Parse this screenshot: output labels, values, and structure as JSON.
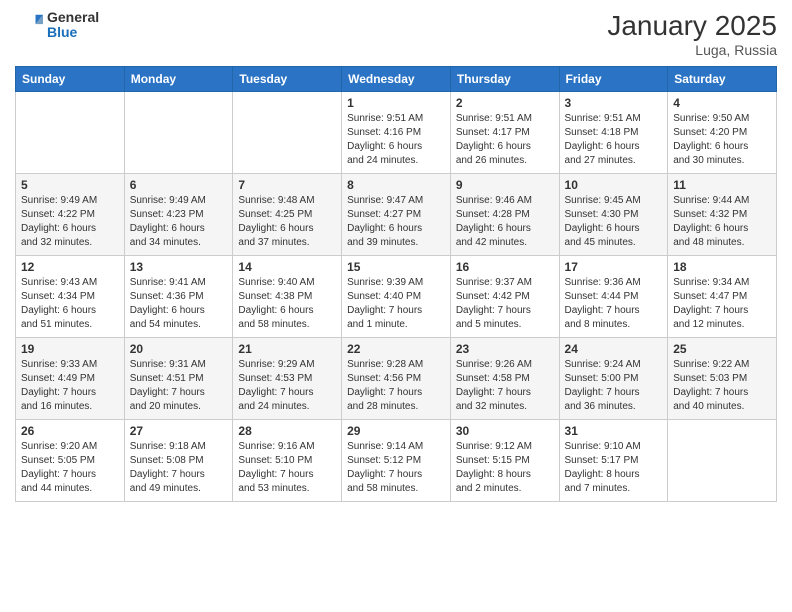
{
  "header": {
    "logo_general": "General",
    "logo_blue": "Blue",
    "month": "January 2025",
    "location": "Luga, Russia"
  },
  "days_of_week": [
    "Sunday",
    "Monday",
    "Tuesday",
    "Wednesday",
    "Thursday",
    "Friday",
    "Saturday"
  ],
  "weeks": [
    [
      {
        "day": "",
        "info": ""
      },
      {
        "day": "",
        "info": ""
      },
      {
        "day": "",
        "info": ""
      },
      {
        "day": "1",
        "info": "Sunrise: 9:51 AM\nSunset: 4:16 PM\nDaylight: 6 hours\nand 24 minutes."
      },
      {
        "day": "2",
        "info": "Sunrise: 9:51 AM\nSunset: 4:17 PM\nDaylight: 6 hours\nand 26 minutes."
      },
      {
        "day": "3",
        "info": "Sunrise: 9:51 AM\nSunset: 4:18 PM\nDaylight: 6 hours\nand 27 minutes."
      },
      {
        "day": "4",
        "info": "Sunrise: 9:50 AM\nSunset: 4:20 PM\nDaylight: 6 hours\nand 30 minutes."
      }
    ],
    [
      {
        "day": "5",
        "info": "Sunrise: 9:49 AM\nSunset: 4:22 PM\nDaylight: 6 hours\nand 32 minutes."
      },
      {
        "day": "6",
        "info": "Sunrise: 9:49 AM\nSunset: 4:23 PM\nDaylight: 6 hours\nand 34 minutes."
      },
      {
        "day": "7",
        "info": "Sunrise: 9:48 AM\nSunset: 4:25 PM\nDaylight: 6 hours\nand 37 minutes."
      },
      {
        "day": "8",
        "info": "Sunrise: 9:47 AM\nSunset: 4:27 PM\nDaylight: 6 hours\nand 39 minutes."
      },
      {
        "day": "9",
        "info": "Sunrise: 9:46 AM\nSunset: 4:28 PM\nDaylight: 6 hours\nand 42 minutes."
      },
      {
        "day": "10",
        "info": "Sunrise: 9:45 AM\nSunset: 4:30 PM\nDaylight: 6 hours\nand 45 minutes."
      },
      {
        "day": "11",
        "info": "Sunrise: 9:44 AM\nSunset: 4:32 PM\nDaylight: 6 hours\nand 48 minutes."
      }
    ],
    [
      {
        "day": "12",
        "info": "Sunrise: 9:43 AM\nSunset: 4:34 PM\nDaylight: 6 hours\nand 51 minutes."
      },
      {
        "day": "13",
        "info": "Sunrise: 9:41 AM\nSunset: 4:36 PM\nDaylight: 6 hours\nand 54 minutes."
      },
      {
        "day": "14",
        "info": "Sunrise: 9:40 AM\nSunset: 4:38 PM\nDaylight: 6 hours\nand 58 minutes."
      },
      {
        "day": "15",
        "info": "Sunrise: 9:39 AM\nSunset: 4:40 PM\nDaylight: 7 hours\nand 1 minute."
      },
      {
        "day": "16",
        "info": "Sunrise: 9:37 AM\nSunset: 4:42 PM\nDaylight: 7 hours\nand 5 minutes."
      },
      {
        "day": "17",
        "info": "Sunrise: 9:36 AM\nSunset: 4:44 PM\nDaylight: 7 hours\nand 8 minutes."
      },
      {
        "day": "18",
        "info": "Sunrise: 9:34 AM\nSunset: 4:47 PM\nDaylight: 7 hours\nand 12 minutes."
      }
    ],
    [
      {
        "day": "19",
        "info": "Sunrise: 9:33 AM\nSunset: 4:49 PM\nDaylight: 7 hours\nand 16 minutes."
      },
      {
        "day": "20",
        "info": "Sunrise: 9:31 AM\nSunset: 4:51 PM\nDaylight: 7 hours\nand 20 minutes."
      },
      {
        "day": "21",
        "info": "Sunrise: 9:29 AM\nSunset: 4:53 PM\nDaylight: 7 hours\nand 24 minutes."
      },
      {
        "day": "22",
        "info": "Sunrise: 9:28 AM\nSunset: 4:56 PM\nDaylight: 7 hours\nand 28 minutes."
      },
      {
        "day": "23",
        "info": "Sunrise: 9:26 AM\nSunset: 4:58 PM\nDaylight: 7 hours\nand 32 minutes."
      },
      {
        "day": "24",
        "info": "Sunrise: 9:24 AM\nSunset: 5:00 PM\nDaylight: 7 hours\nand 36 minutes."
      },
      {
        "day": "25",
        "info": "Sunrise: 9:22 AM\nSunset: 5:03 PM\nDaylight: 7 hours\nand 40 minutes."
      }
    ],
    [
      {
        "day": "26",
        "info": "Sunrise: 9:20 AM\nSunset: 5:05 PM\nDaylight: 7 hours\nand 44 minutes."
      },
      {
        "day": "27",
        "info": "Sunrise: 9:18 AM\nSunset: 5:08 PM\nDaylight: 7 hours\nand 49 minutes."
      },
      {
        "day": "28",
        "info": "Sunrise: 9:16 AM\nSunset: 5:10 PM\nDaylight: 7 hours\nand 53 minutes."
      },
      {
        "day": "29",
        "info": "Sunrise: 9:14 AM\nSunset: 5:12 PM\nDaylight: 7 hours\nand 58 minutes."
      },
      {
        "day": "30",
        "info": "Sunrise: 9:12 AM\nSunset: 5:15 PM\nDaylight: 8 hours\nand 2 minutes."
      },
      {
        "day": "31",
        "info": "Sunrise: 9:10 AM\nSunset: 5:17 PM\nDaylight: 8 hours\nand 7 minutes."
      },
      {
        "day": "",
        "info": ""
      }
    ]
  ]
}
